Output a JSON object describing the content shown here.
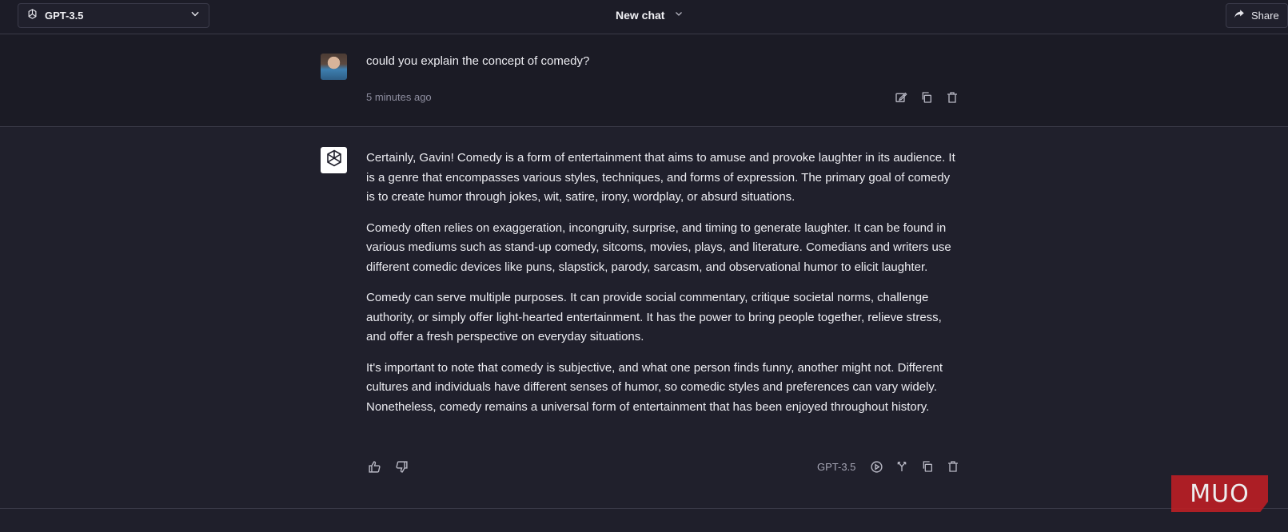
{
  "header": {
    "model_label": "GPT-3.5",
    "chat_title": "New chat",
    "share_label": "Share"
  },
  "user_message": {
    "text": "could you explain the concept of comedy?",
    "timestamp": "5 minutes ago"
  },
  "assistant_message": {
    "paragraphs": [
      "Certainly, Gavin! Comedy is a form of entertainment that aims to amuse and provoke laughter in its audience. It is a genre that encompasses various styles, techniques, and forms of expression. The primary goal of comedy is to create humor through jokes, wit, satire, irony, wordplay, or absurd situations.",
      "Comedy often relies on exaggeration, incongruity, surprise, and timing to generate laughter. It can be found in various mediums such as stand-up comedy, sitcoms, movies, plays, and literature. Comedians and writers use different comedic devices like puns, slapstick, parody, sarcasm, and observational humor to elicit laughter.",
      "Comedy can serve multiple purposes. It can provide social commentary, critique societal norms, challenge authority, or simply offer light-hearted entertainment. It has the power to bring people together, relieve stress, and offer a fresh perspective on everyday situations.",
      "It's important to note that comedy is subjective, and what one person finds funny, another might not. Different cultures and individuals have different senses of humor, so comedic styles and preferences can vary widely. Nonetheless, comedy remains a universal form of entertainment that has been enjoyed throughout history."
    ],
    "model_tag": "GPT-3.5"
  },
  "watermark": {
    "text": "MUO"
  },
  "colors": {
    "background": "#1f1f2b",
    "header": "#1c1c27",
    "watermark": "#b91f25"
  }
}
